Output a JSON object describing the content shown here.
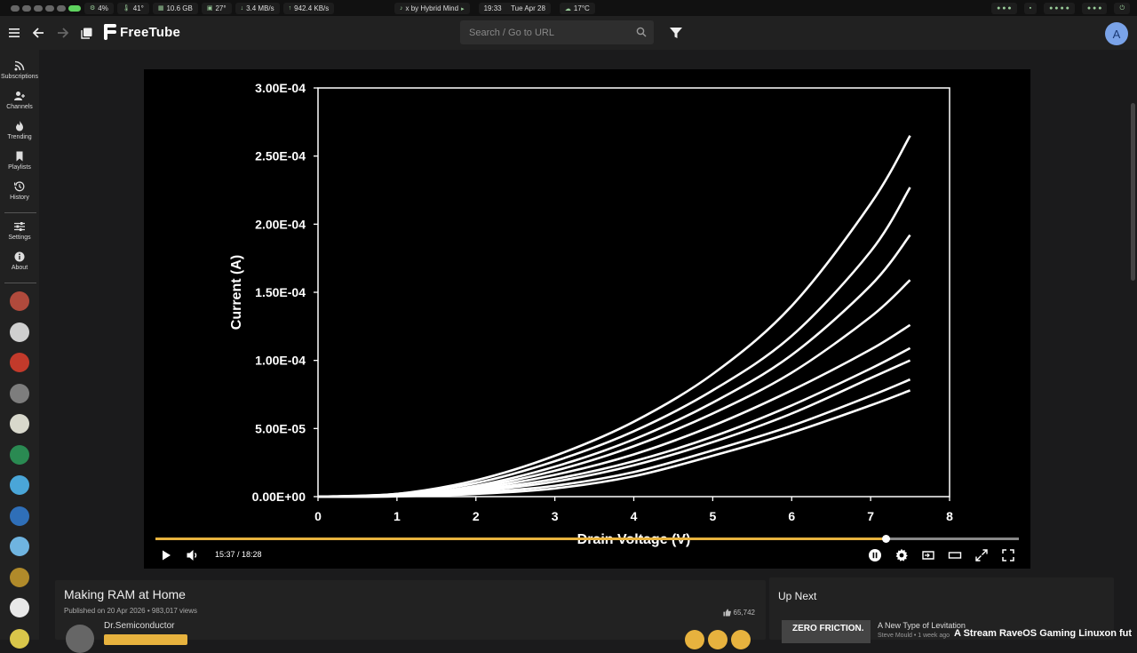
{
  "sysbar": {
    "cpu": "4%",
    "temp1": "41°",
    "mem": "10.6 GB",
    "temp2": "27°",
    "net_down": "3.4 MB/s",
    "net_up": "942.4 KB/s",
    "media": "x by Hybrid Mind",
    "time": "19:33",
    "date": "Tue Apr 28",
    "weather": "17°C"
  },
  "header": {
    "app_name": "FreeTube",
    "search_placeholder": "Search / Go to URL",
    "avatar_letter": "A"
  },
  "sidebar": {
    "items": [
      {
        "label": "Subscriptions",
        "icon": "rss-icon"
      },
      {
        "label": "Channels",
        "icon": "users-icon"
      },
      {
        "label": "Trending",
        "icon": "fire-icon"
      },
      {
        "label": "Playlists",
        "icon": "bookmark-icon"
      },
      {
        "label": "History",
        "icon": "history-icon"
      },
      {
        "label": "Settings",
        "icon": "sliders-icon"
      },
      {
        "label": "About",
        "icon": "info-icon"
      }
    ],
    "channel_colors": [
      "#b04a3c",
      "#cfcfcf",
      "#c23a2b",
      "#7d7d7d",
      "#d8d8cc",
      "#2a8a52",
      "#4aa6d8",
      "#2f6fb8",
      "#6fb4e0",
      "#b08a2a",
      "#e8e8e8",
      "#d9c64a"
    ]
  },
  "player": {
    "current_time": "15:37",
    "duration": "18:28",
    "time_display": "15:37 / 18:28",
    "progress": 0.846,
    "progress_color": "#e7b23e"
  },
  "chart_data": {
    "type": "line",
    "xlabel": "Drain Voltage (V)",
    "ylabel": "Current (A)",
    "xlim": [
      0,
      8
    ],
    "ylim": [
      0,
      0.0003
    ],
    "x_ticks": [
      "0",
      "1",
      "2",
      "3",
      "4",
      "5",
      "6",
      "7",
      "8"
    ],
    "y_ticks": [
      "0.00E+00",
      "5.00E-05",
      "1.00E-04",
      "1.50E-04",
      "2.00E-04",
      "2.50E-04",
      "3.00E-04"
    ],
    "x": [
      0,
      1,
      2,
      3,
      4,
      5,
      6,
      7,
      7.5
    ],
    "series": [
      {
        "values": [
          0,
          2e-06,
          1.2e-05,
          3e-05,
          5.5e-05,
          9e-05,
          0.00014,
          0.000215,
          0.000265
        ]
      },
      {
        "values": [
          0,
          2e-06,
          1e-05,
          2.6e-05,
          4.8e-05,
          7.8e-05,
          0.000118,
          0.00018,
          0.000227
        ]
      },
      {
        "values": [
          0,
          1e-06,
          8e-06,
          2.2e-05,
          4.2e-05,
          6.9e-05,
          0.000104,
          0.000155,
          0.000192
        ]
      },
      {
        "values": [
          0,
          1e-06,
          7e-06,
          1.9e-05,
          3.7e-05,
          6.1e-05,
          9.1e-05,
          0.000132,
          0.000159
        ]
      },
      {
        "values": [
          0,
          1e-06,
          6e-06,
          1.6e-05,
          3.1e-05,
          5.2e-05,
          7.8e-05,
          0.000108,
          0.000126
        ]
      },
      {
        "values": [
          0,
          5e-07,
          5e-06,
          1.3e-05,
          2.6e-05,
          4.4e-05,
          6.7e-05,
          9.4e-05,
          0.000109
        ]
      },
      {
        "values": [
          0,
          5e-07,
          4e-06,
          1.1e-05,
          2.3e-05,
          4e-05,
          6.1e-05,
          8.7e-05,
          0.0001
        ]
      },
      {
        "values": [
          0,
          3e-07,
          3e-06,
          8e-06,
          1.8e-05,
          3.4e-05,
          5.2e-05,
          7.4e-05,
          8.6e-05
        ]
      },
      {
        "values": [
          0,
          2e-07,
          2e-06,
          6e-06,
          1.5e-05,
          3e-05,
          4.7e-05,
          6.7e-05,
          7.8e-05
        ]
      }
    ]
  },
  "video": {
    "title": "Making RAM at Home",
    "published": "Published on 20 Apr 2026 • 983,017 views",
    "channel": "Dr.Semiconductor",
    "likes": "65,742"
  },
  "upnext": {
    "title": "Up Next",
    "thumb_text": "ZERO FRICTION.",
    "video_title": "A New Type of Levitation",
    "video_meta": "Steve Mould • 1 week ago"
  },
  "ticker": "A Stream RaveOS Gaming Linuxon fut"
}
